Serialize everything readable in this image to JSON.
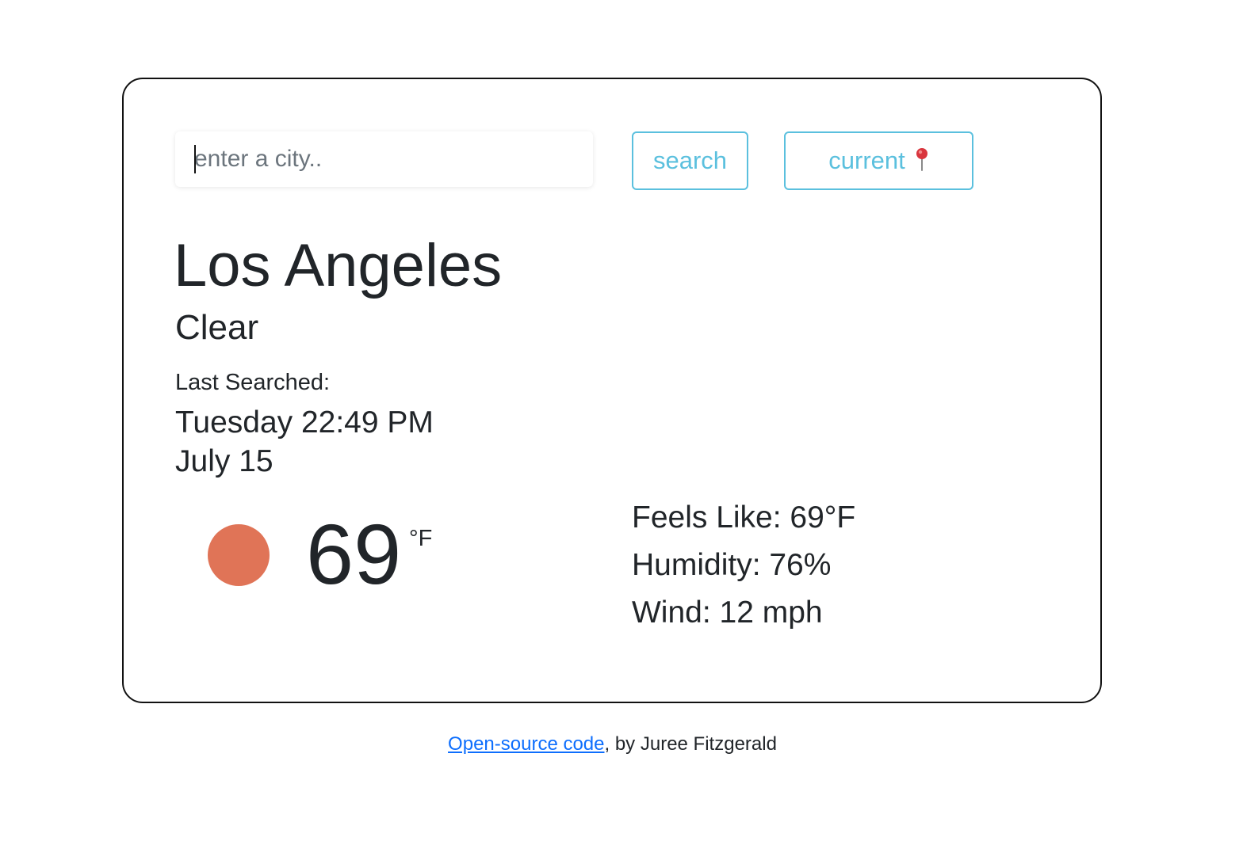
{
  "search": {
    "placeholder": "enter a city..",
    "value": "",
    "search_label": "search",
    "current_label": "current"
  },
  "weather": {
    "city": "Los Angeles",
    "description": "Clear",
    "last_searched_label": "Last Searched:",
    "last_searched_time": "Tuesday 22:49 PM",
    "last_searched_date": "July 15",
    "icon": "sun-icon",
    "temperature": "69",
    "unit": "°F",
    "feels_like": "Feels Like: 69°F",
    "humidity": "Humidity: 76%",
    "wind": "Wind: 12 mph"
  },
  "footer": {
    "link_text": "Open-source code",
    "author_text": ", by Juree Fitzgerald"
  },
  "colors": {
    "accent": "#5bc0de",
    "icon": "#e07457",
    "link": "#0d6efd",
    "border": "#111111"
  }
}
